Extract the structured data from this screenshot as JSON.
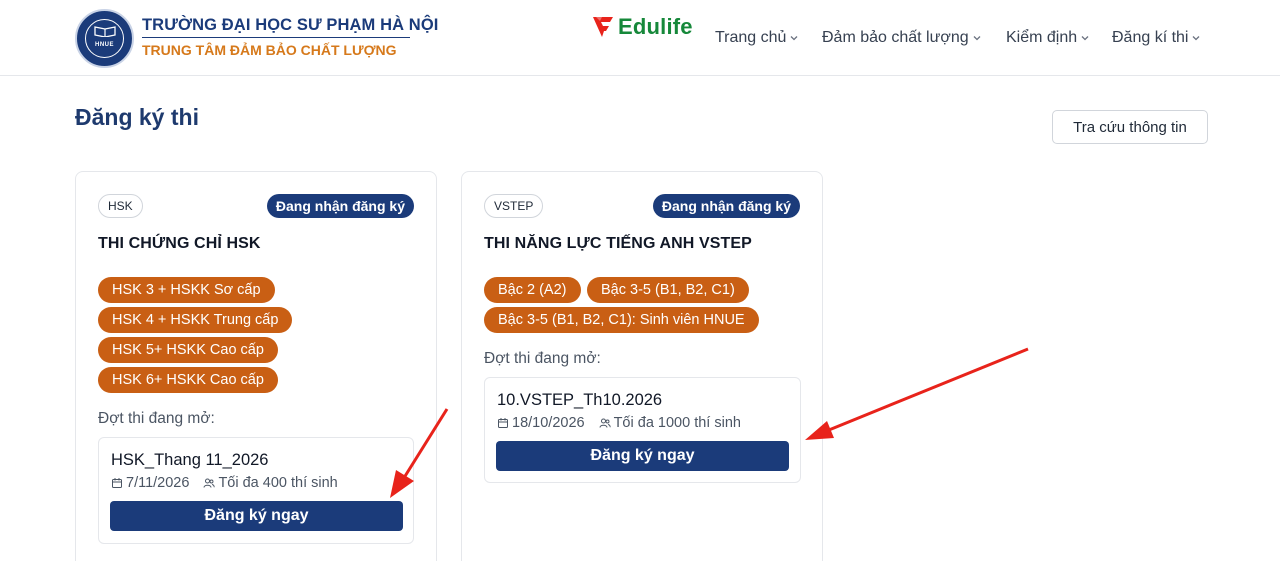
{
  "header": {
    "university_name": "TRƯỜNG ĐẠI HỌC SƯ PHẠM HÀ NỘI",
    "center_name": "TRUNG TÂM ĐẢM BẢO CHẤT LƯỢNG",
    "logo_text": "HNUE",
    "partner_brand": "Edulife",
    "partner_color": "#16883a",
    "nav": [
      {
        "label": "Trang chủ",
        "icon": "chevron-down-icon"
      },
      {
        "label": "Đảm bảo chất lượng",
        "icon": "chevron-down-icon"
      },
      {
        "label": "Kiểm định",
        "icon": "chevron-down-icon"
      },
      {
        "label": "Đăng kí thi",
        "icon": "chevron-down-icon"
      }
    ]
  },
  "page": {
    "title": "Đăng ký thi",
    "lookup_button": "Tra cứu thông tin"
  },
  "colors": {
    "primary": "#1b3b7a",
    "level_pill": "#c95f14",
    "annotation_arrow": "#e8231b"
  },
  "cards": [
    {
      "code": "HSK",
      "status": "Đang nhận đăng ký",
      "title": "THI CHỨNG CHỈ HSK",
      "levels": [
        "HSK 3 + HSKK Sơ cấp",
        "HSK 4 + HSKK Trung cấp",
        "HSK 5+ HSKK Cao cấp",
        "HSK 6+ HSKK Cao cấp"
      ],
      "open_label": "Đợt thi đang mở:",
      "session": {
        "name": "HSK_Thang 11_2026",
        "date": "7/11/2026",
        "capacity": "Tối đa 400 thí sinh",
        "button": "Đăng ký ngay"
      }
    },
    {
      "code": "VSTEP",
      "status": "Đang nhận đăng ký",
      "title": "THI NĂNG LỰC TIẾNG ANH VSTEP",
      "levels": [
        "Bậc 2 (A2)",
        "Bậc 3-5 (B1, B2, C1)",
        "Bậc 3-5 (B1, B2, C1): Sinh viên HNUE"
      ],
      "open_label": "Đợt thi đang mở:",
      "session": {
        "name": "10.VSTEP_Th10.2026",
        "date": "18/10/2026",
        "capacity": "Tối đa 1000 thí sinh",
        "button": "Đăng ký ngay"
      }
    }
  ]
}
